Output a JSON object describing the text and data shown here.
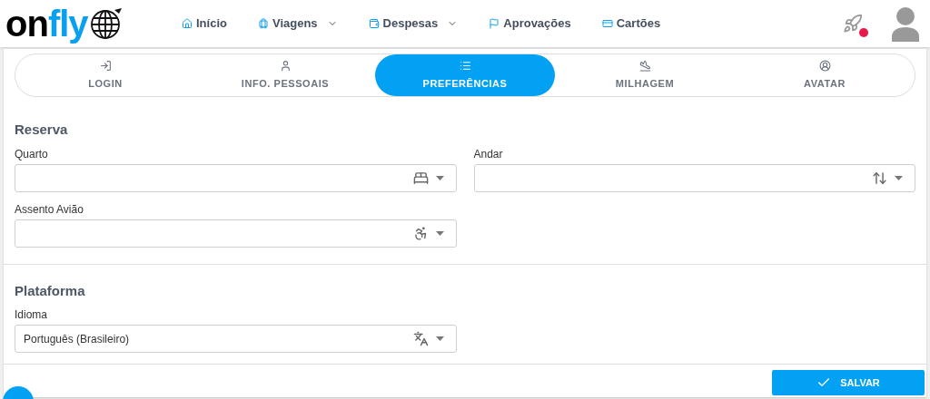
{
  "logo": {
    "text_dark": "on",
    "text_accent": "fly"
  },
  "nav": [
    {
      "label": "Início",
      "dropdown": false
    },
    {
      "label": "Viagens",
      "dropdown": true
    },
    {
      "label": "Despesas",
      "dropdown": true
    },
    {
      "label": "Aprovações",
      "dropdown": false
    },
    {
      "label": "Cartões",
      "dropdown": false
    }
  ],
  "notification": {
    "unread": true
  },
  "tabs": [
    {
      "label": "LOGIN",
      "selected": false
    },
    {
      "label": "INFO. PESSOAIS",
      "selected": false
    },
    {
      "label": "PREFERÊNCIAS",
      "selected": true
    },
    {
      "label": "MILHAGEM",
      "selected": false
    },
    {
      "label": "AVATAR",
      "selected": false
    }
  ],
  "sections": [
    {
      "title": "Reserva",
      "fields": [
        {
          "label": "Quarto"
        },
        {
          "label": "Andar"
        },
        {
          "label": "Assento Avião"
        }
      ]
    },
    {
      "title": "Plataforma",
      "fields": [
        {
          "label": "Idioma",
          "value": "Português (Brasileiro)"
        }
      ]
    }
  ],
  "save_button": "SALVAR"
}
